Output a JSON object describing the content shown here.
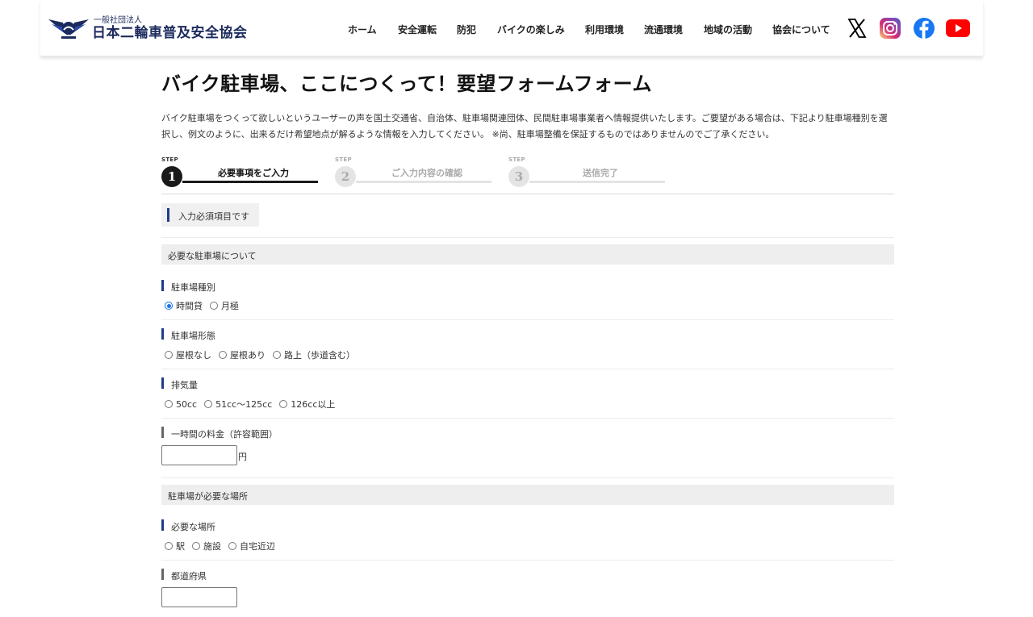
{
  "header": {
    "logo_sub": "一般社団法人",
    "logo_main": "日本二輪車普及安全協会",
    "nav": [
      "ホーム",
      "安全運転",
      "防犯",
      "バイクの楽しみ",
      "利用環境",
      "流通環境",
      "地域の活動",
      "協会について"
    ],
    "social": [
      {
        "name": "x-icon",
        "color": "#000000"
      },
      {
        "name": "instagram-icon",
        "color": "#d6249f"
      },
      {
        "name": "facebook-icon",
        "color": "#1877f2"
      },
      {
        "name": "youtube-icon",
        "color": "#ff0000"
      }
    ]
  },
  "main": {
    "title": "バイク駐車場、ここにつくって！要望フォームフォーム",
    "intro_line1": "バイク駐車場をつくって欲しいというユーザーの声を国土交通省、自治体、駐車場関連団体、民間駐車場事業者へ情報提供いたします。ご要望がある場合は、下記より駐車場種別を選",
    "intro_line2": "択し、例文のように、出来るだけ希望地点が解るような情報を入力してください。 ※尚、駐車場整備を保証するものではありませんのでご了承ください。",
    "steps": [
      {
        "label": "STEP",
        "num": "1",
        "text": "必要事項をご入力",
        "active": true
      },
      {
        "label": "STEP",
        "num": "2",
        "text": "ご入力内容の確認",
        "active": false
      },
      {
        "label": "STEP",
        "num": "3",
        "text": "送信完了",
        "active": false
      }
    ],
    "required_note": "入力必須項目です"
  },
  "form": {
    "section1": "必要な駐車場について",
    "parking_type": {
      "label": "駐車場種別",
      "options": [
        "時間貸",
        "月極"
      ],
      "selected": "時間貸"
    },
    "parking_form": {
      "label": "駐車場形態",
      "options": [
        "屋根なし",
        "屋根あり",
        "路上（歩道含む）"
      ]
    },
    "displacement": {
      "label": "排気量",
      "options": [
        "50cc",
        "51cc〜125cc",
        "126cc以上"
      ]
    },
    "fee": {
      "label": "一時間の料金（許容範囲）",
      "value": "",
      "unit": "円"
    },
    "section2": "駐車場が必要な場所",
    "location": {
      "label": "必要な場所",
      "options": [
        "駅",
        "施設",
        "自宅近辺"
      ]
    },
    "prefecture": {
      "label": "都道府県",
      "value": ""
    }
  },
  "colors": {
    "accent_blue": "#1f3c88",
    "step_active": "#1a1a1a"
  }
}
